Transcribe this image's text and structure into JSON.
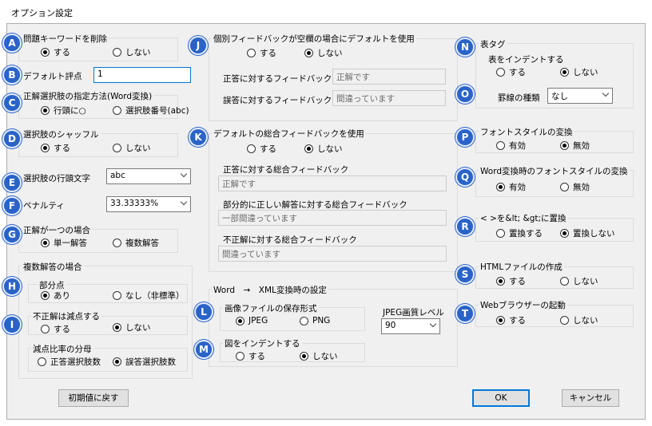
{
  "window": {
    "title": "オプション設定"
  },
  "common": {
    "yes": "する",
    "no": "しない"
  },
  "badges": [
    "A",
    "B",
    "C",
    "D",
    "E",
    "F",
    "G",
    "H",
    "I",
    "J",
    "K",
    "L",
    "M",
    "N",
    "O",
    "P",
    "Q",
    "R",
    "S",
    "T"
  ],
  "left": {
    "delete_keyword": {
      "title": "問題キーワードを削除",
      "selected": "yes"
    },
    "default_score": {
      "label": "デフォルト評点",
      "value": "1"
    },
    "choice_method": {
      "title": "正解選択肢の指定方法(Word変換)",
      "opt1": "行頭に○",
      "opt2": "選択肢番号(abc)",
      "selected": "opt1"
    },
    "shuffle": {
      "title": "選択肢のシャッフル",
      "selected": "yes"
    },
    "line_head": {
      "label": "選択肢の行頭文字",
      "value": "abc"
    },
    "penalty": {
      "label": "ペナルティ",
      "value": "33.33333%"
    },
    "single_answer": {
      "title": "正解が一つの場合",
      "opt1": "単一解答",
      "opt2": "複数解答",
      "selected": "opt1"
    },
    "multi": {
      "title": "複数解答の場合",
      "partial": {
        "title": "部分点",
        "opt1": "あり",
        "opt2": "なし（非標準）",
        "selected": "opt1"
      },
      "deduct": {
        "title": "不正解は減点する",
        "selected": "no"
      },
      "denominator": {
        "title": "減点比率の分母",
        "opt1": "正答選択肢数",
        "opt2": "誤答選択肢数",
        "selected": "opt2"
      }
    },
    "reset_button": "初期値に戻す"
  },
  "middle": {
    "individual_fb": {
      "title": "個別フィードバックが空欄の場合にデフォルトを使用",
      "selected": "no",
      "correct_label": "正答に対するフィードバック",
      "correct_value": "正解です",
      "wrong_label": "誤答に対するフィードバック",
      "wrong_value": "間違っています"
    },
    "overall_fb": {
      "title": "デフォルトの総合フィードバックを使用",
      "selected": "no",
      "correct_label": "正答に対する総合フィードバック",
      "correct_value": "正解です",
      "partial_label": "部分的に正しい解答に対する総合フィードバック",
      "partial_value": "一部間違っています",
      "wrong_label": "不正解に対する総合フィードバック",
      "wrong_value": "間違っています"
    },
    "word_xml": {
      "title": "Word　→　XML変換時の設定",
      "image_format": {
        "title": "画像ファイルの保存形式",
        "opt1": "JPEG",
        "opt2": "PNG",
        "selected": "opt1"
      },
      "jpeg_quality": {
        "label": "JPEG画質レベル",
        "value": "90"
      },
      "indent_figure": {
        "title": "図をインデントする",
        "selected": "no"
      }
    }
  },
  "right": {
    "table_tag": {
      "title": "表タグ",
      "indent_title": "表をインデントする",
      "selected": "no",
      "border_label": "罫線の種類",
      "border_value": "なし"
    },
    "font_style": {
      "title": "フォントスタイルの変換",
      "opt1": "有効",
      "opt2": "無効",
      "selected": "opt2"
    },
    "word_font": {
      "title": "Word変換時のフォントスタイルの変換",
      "opt1": "有効",
      "opt2": "無効",
      "selected": "opt1"
    },
    "replace": {
      "title": "< >を&lt; &gt;に置換",
      "opt1": "置換する",
      "opt2": "置換しない",
      "selected": "opt2"
    },
    "html_file": {
      "title": "HTMLファイルの作成",
      "selected": "yes"
    },
    "browser": {
      "title": "Webブラウザーの起動",
      "selected": "yes"
    }
  },
  "footer": {
    "ok": "OK",
    "cancel": "キャンセル"
  },
  "colors": {
    "badge": "#2a63c8",
    "focus_border": "#0078d7"
  }
}
